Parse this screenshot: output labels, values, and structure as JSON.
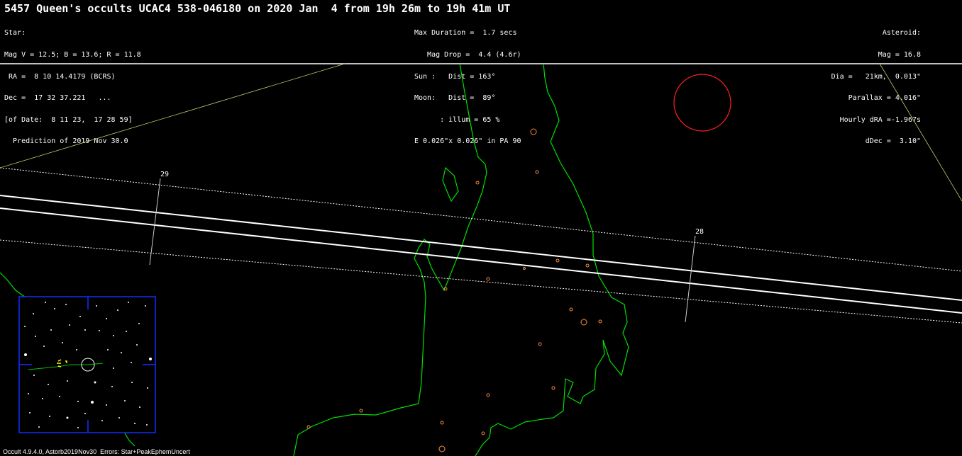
{
  "title": "5457 Queen's occults UCAC4 538-046180 on 2020 Jan  4 from 19h 26m to 19h 41m UT",
  "star_block": [
    "Star:",
    "Mag V = 12.5; B = 13.6; R = 11.8",
    " RA =  8 10 14.4179 (BCRS)",
    "Dec =  17 32 37.221   ...",
    "[of Date:  8 11 23,  17 28 59]",
    "  Prediction of 2019 Nov 30.0"
  ],
  "event_block": [
    "Max Duration =  1.7 secs",
    "   Mag Drop =  4.4 (4.6r)",
    "Sun :   Dist = 163°",
    "Moon:   Dist =  89°",
    "      : illum = 65 %",
    "E 0.026\"x 0.026\" in PA 90"
  ],
  "asteroid_block": [
    "Asteroid:",
    "Mag = 16.8",
    "Dia =   21km,  0.013\"",
    "Parallax = 4.016\"",
    "Hourly dRA =-1.967s",
    "dDec =  3.10\""
  ],
  "time_ticks": [
    "29",
    "28"
  ],
  "footer": "Occult 4.9.4.0, Astorb2019Nov30  Errors: Star+PeakEphemUncert",
  "colors": {
    "background": "#000000",
    "coastline": "#00e000",
    "path_center": "#ffffff",
    "sites": "#ff8c3c",
    "star_disc": "#ff2020",
    "finder_border": "#1030ff"
  }
}
